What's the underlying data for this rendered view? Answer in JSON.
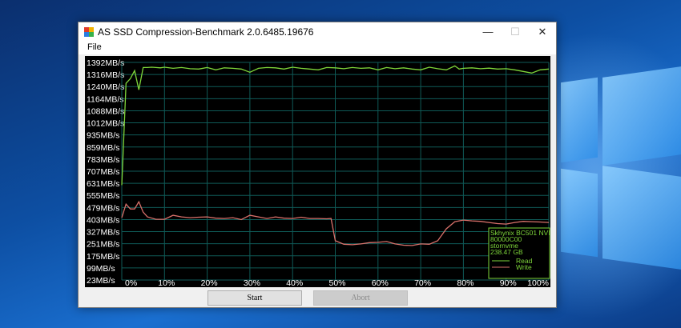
{
  "window": {
    "title": "AS SSD Compression-Benchmark 2.0.6485.19676",
    "minimize_glyph": "—",
    "maximize_glyph": "☐",
    "close_glyph": "✕"
  },
  "menu": {
    "file_label": "File"
  },
  "buttons": {
    "start_label": "Start",
    "abort_label": "Abort"
  },
  "colors": {
    "read_line": "#7ed63a",
    "write_line": "#d8706a",
    "grid": "#0f5a57",
    "axis_text": "#ffffff",
    "legend_text": "#7ed63a"
  },
  "chart_data": {
    "type": "line",
    "y_tick_labels": [
      "1392MB/s",
      "1316MB/s",
      "1240MB/s",
      "1164MB/s",
      "1088MB/s",
      "1012MB/s",
      "935MB/s",
      "859MB/s",
      "783MB/s",
      "707MB/s",
      "631MB/s",
      "555MB/s",
      "479MB/s",
      "403MB/s",
      "327MB/s",
      "251MB/s",
      "175MB/s",
      "99MB/s",
      "23MB/s"
    ],
    "x_tick_labels": [
      "0%",
      "10%",
      "20%",
      "30%",
      "40%",
      "50%",
      "60%",
      "70%",
      "80%",
      "90%",
      "100%"
    ],
    "ylim": [
      23,
      1392
    ],
    "xlim": [
      0,
      100
    ],
    "legend": {
      "lines": [
        "Skhynix BC501 NVI",
        "80000C00",
        "stornvme",
        "238.47 GB"
      ],
      "series_labels": [
        "Read",
        "Write"
      ],
      "placement": "bottom-right"
    },
    "series": [
      {
        "name": "Read",
        "x": [
          0,
          1,
          2,
          3,
          4,
          5,
          6,
          7,
          8,
          9,
          10,
          12,
          14,
          16,
          18,
          20,
          22,
          24,
          26,
          28,
          30,
          32,
          34,
          36,
          38,
          40,
          42,
          44,
          46,
          48,
          50,
          52,
          54,
          56,
          58,
          60,
          62,
          64,
          66,
          68,
          70,
          72,
          74,
          76,
          78,
          79,
          80,
          82,
          84,
          86,
          88,
          90,
          92,
          94,
          96,
          98,
          100
        ],
        "values": [
          620,
          1260,
          1290,
          1340,
          1220,
          1360,
          1360,
          1362,
          1360,
          1358,
          1362,
          1355,
          1360,
          1352,
          1350,
          1360,
          1345,
          1358,
          1355,
          1350,
          1330,
          1355,
          1360,
          1358,
          1350,
          1362,
          1355,
          1350,
          1345,
          1360,
          1358,
          1352,
          1360,
          1355,
          1358,
          1345,
          1360,
          1352,
          1358,
          1350,
          1345,
          1362,
          1352,
          1345,
          1370,
          1350,
          1355,
          1358,
          1352,
          1356,
          1350,
          1352,
          1345,
          1335,
          1325,
          1345,
          1350
        ]
      },
      {
        "name": "Write",
        "x": [
          0,
          1,
          2,
          3,
          4,
          5,
          6,
          8,
          10,
          12,
          14,
          16,
          18,
          20,
          22,
          24,
          26,
          28,
          30,
          32,
          34,
          36,
          38,
          40,
          42,
          44,
          46,
          48,
          49,
          50,
          52,
          54,
          56,
          58,
          60,
          62,
          64,
          66,
          68,
          70,
          72,
          74,
          76,
          78,
          80,
          82,
          84,
          86,
          88,
          90,
          92,
          94,
          96,
          98,
          100
        ],
        "values": [
          415,
          500,
          470,
          470,
          515,
          450,
          420,
          405,
          405,
          430,
          420,
          415,
          418,
          420,
          412,
          410,
          415,
          403,
          430,
          420,
          410,
          420,
          412,
          410,
          418,
          410,
          410,
          408,
          410,
          270,
          248,
          245,
          250,
          258,
          260,
          265,
          250,
          242,
          240,
          250,
          248,
          270,
          345,
          390,
          400,
          395,
          392,
          385,
          378,
          375,
          385,
          392,
          390,
          388,
          385
        ]
      }
    ]
  }
}
